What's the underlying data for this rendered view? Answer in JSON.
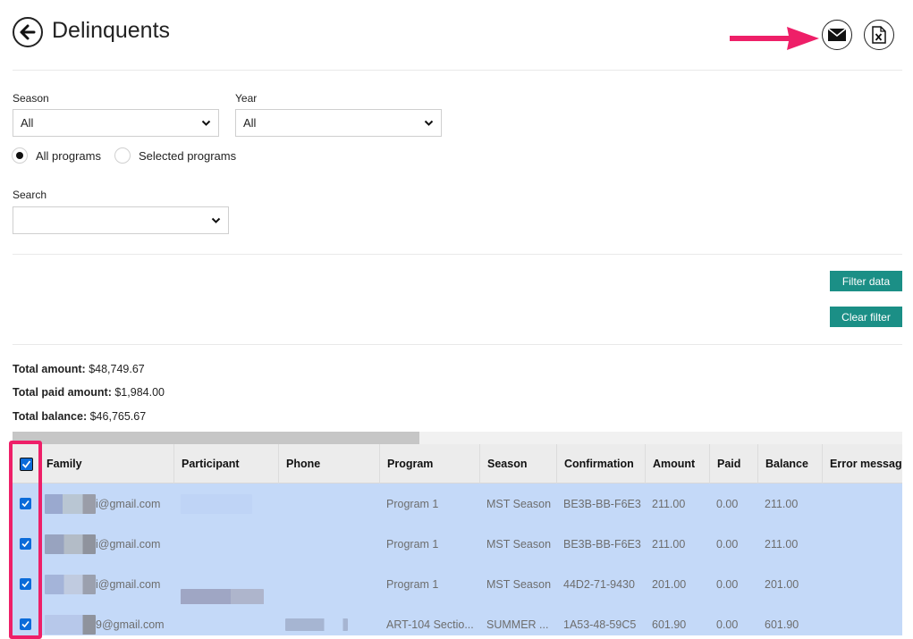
{
  "header": {
    "title": "Delinquents"
  },
  "filters": {
    "season_label": "Season",
    "season_value": "All",
    "year_label": "Year",
    "year_value": "All",
    "radio_all": "All programs",
    "radio_selected": "Selected programs",
    "search_label": "Search",
    "search_value": ""
  },
  "actions": {
    "filter_data": "Filter data",
    "clear_filter": "Clear filter"
  },
  "totals": {
    "amount_label": "Total amount:",
    "amount_value": "$48,749.67",
    "paid_label": "Total paid amount:",
    "paid_value": "$1,984.00",
    "balance_label": "Total balance:",
    "balance_value": "$46,765.67"
  },
  "table": {
    "columns": [
      "Family",
      "Participant",
      "Phone",
      "Program",
      "Season",
      "Confirmation",
      "Amount",
      "Paid",
      "Balance",
      "Error message"
    ],
    "rows": [
      {
        "family": "i@gmail.com",
        "participant": "",
        "phone": "",
        "program": "Program 1",
        "season": "MST Season",
        "confirmation": "BE3B-BB-F6E3",
        "amount": "211.00",
        "paid": "0.00",
        "balance": "211.00",
        "error": ""
      },
      {
        "family": "i@gmail.com",
        "participant": "",
        "phone": "",
        "program": "Program 1",
        "season": "MST Season",
        "confirmation": "BE3B-BB-F6E3",
        "amount": "211.00",
        "paid": "0.00",
        "balance": "211.00",
        "error": ""
      },
      {
        "family": "i@gmail.com",
        "participant": "",
        "phone": "",
        "program": "Program 1",
        "season": "MST Season",
        "confirmation": "44D2-71-9430",
        "amount": "201.00",
        "paid": "0.00",
        "balance": "201.00",
        "error": ""
      },
      {
        "family": "9@gmail.com",
        "participant": "",
        "phone": "",
        "program": "ART-104 Sectio...",
        "season": "SUMMER ...",
        "confirmation": "1A53-48-59C5",
        "amount": "601.90",
        "paid": "0.00",
        "balance": "601.90",
        "error": ""
      }
    ]
  },
  "colors": {
    "accent": "#1b8f86",
    "row_selected": "#c4d9f8",
    "highlight": "#ee1f68",
    "checkbox": "#0b6bd9"
  }
}
